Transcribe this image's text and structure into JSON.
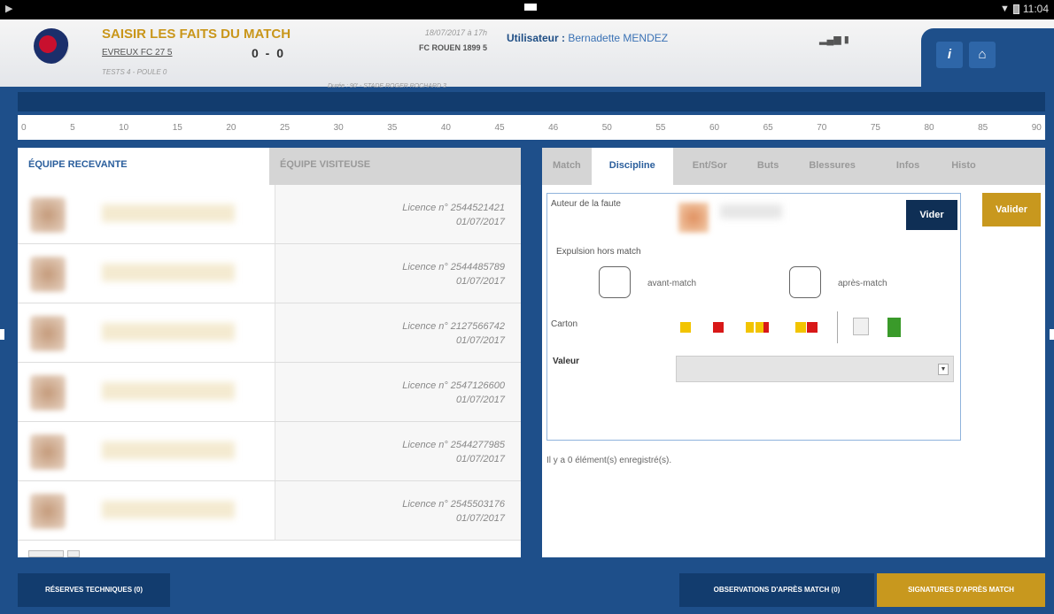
{
  "statusbar": {
    "time": "11:04",
    "left_glyph": "▶",
    "wifi_icon": "wifi-icon",
    "battery_icon": "battery-icon"
  },
  "header": {
    "title": "SAISIR LES FAITS DU MATCH",
    "home_team": "EVREUX FC 27 5",
    "score": "0 - 0",
    "competition": "TESTS 4 - POULE 0",
    "date": "18/07/2017 à 17h",
    "away_team": "FC ROUEN 1899 5",
    "venue": "Durée : 90' - STADE ROGER ROCHARD 3",
    "user_label": "Utilisateur :",
    "user_name": "Bernadette MENDEZ",
    "info_label": "i",
    "home_icon": "⌂"
  },
  "timeline": [
    "0",
    "5",
    "10",
    "15",
    "20",
    "25",
    "30",
    "35",
    "40",
    "45",
    "46",
    "50",
    "55",
    "60",
    "65",
    "70",
    "75",
    "80",
    "85",
    "90"
  ],
  "left_panel": {
    "tab_home": "ÉQUIPE RECEVANTE",
    "tab_away": "ÉQUIPE VISITEUSE",
    "players": [
      {
        "licence": "Licence n° 2544521421",
        "date": "01/07/2017"
      },
      {
        "licence": "Licence n° 2544485789",
        "date": "01/07/2017"
      },
      {
        "licence": "Licence n° 2127566742",
        "date": "01/07/2017"
      },
      {
        "licence": "Licence n° 2547126600",
        "date": "01/07/2017"
      },
      {
        "licence": "Licence n° 2544277985",
        "date": "01/07/2017"
      },
      {
        "licence": "Licence n° 2545503176",
        "date": "01/07/2017"
      }
    ]
  },
  "right_panel": {
    "tabs": [
      "Match",
      "Discipline",
      "Ent/Sor",
      "Buts",
      "Blessures",
      "Infos",
      "Histo"
    ],
    "auteur_label": "Auteur de la faute",
    "vider_label": "Vider",
    "valider_label": "Valider",
    "expulsion_label": "Expulsion hors match",
    "avant_label": "avant-match",
    "apres_label": "après-match",
    "carton_label": "Carton",
    "valeur_label": "Valeur",
    "select_value": "",
    "count_text": "Il y a 0 élément(s) enregistré(s)."
  },
  "colors": {
    "yellow_card": "#f2c400",
    "red_card": "#d81818",
    "green_card": "#3a9a2a",
    "white_card": "#f0f0f0",
    "accent_gold": "#c8981e",
    "navy": "#123c6e"
  },
  "footer": {
    "reserves": "RÉSERVES TECHNIQUES (0)",
    "observations": "OBSERVATIONS D'APRÈS MATCH (0)",
    "signatures": "SIGNATURES D'APRÈS MATCH"
  }
}
